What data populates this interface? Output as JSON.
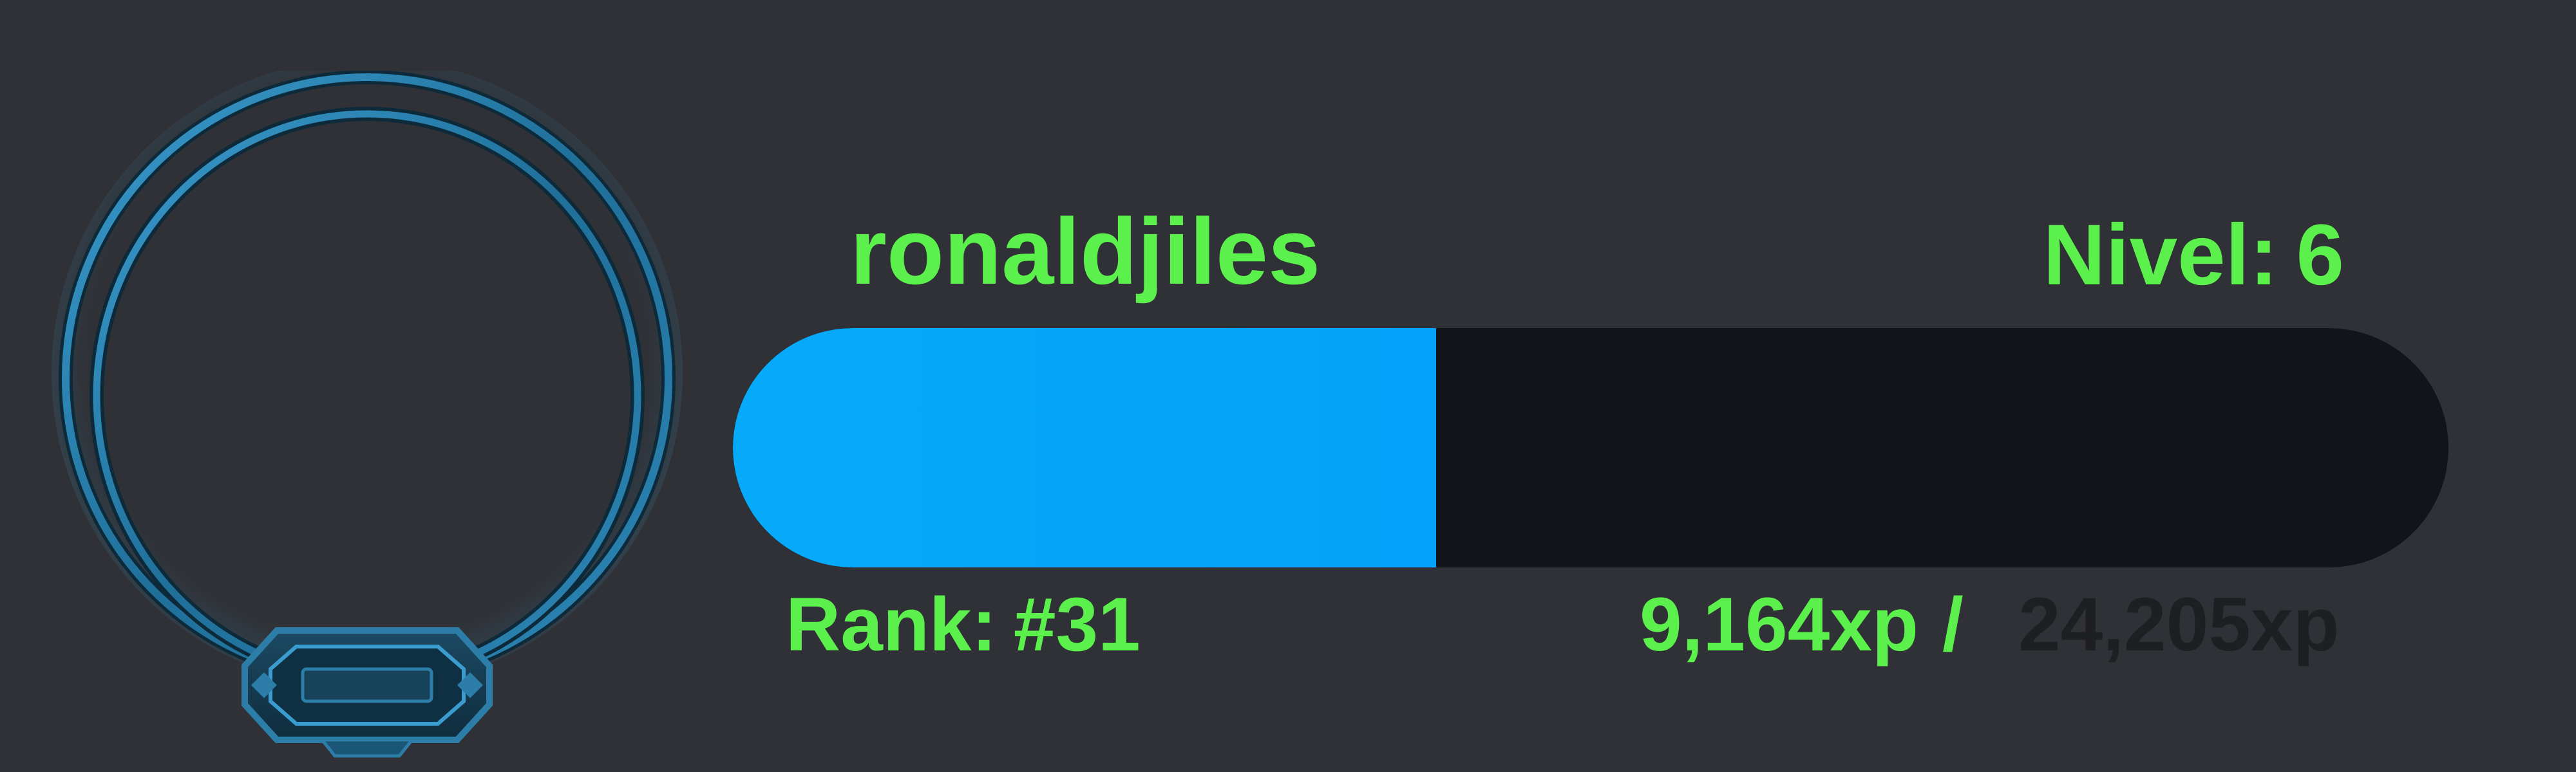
{
  "profile": {
    "username": "ronaldjiles",
    "level_label": "Nivel:",
    "level_value": "6",
    "rank_label": "Rank:",
    "rank_value": "#31"
  },
  "xp": {
    "current": "9,164xp",
    "separator": "/",
    "total": "24,205xp",
    "progress_fraction": 0.41
  },
  "colors": {
    "background": "#2f3136",
    "text_accent": "#5cf04d",
    "bar_fill": "#04a2fa",
    "bar_track": "#131419",
    "xp_total_text": "#1e1f23",
    "frame": "#2c7da8"
  },
  "icons": {
    "avatar_frame": "avatar-frame-icon"
  }
}
